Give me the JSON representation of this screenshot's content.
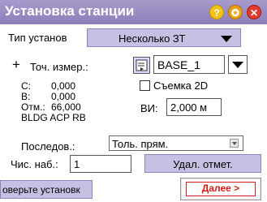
{
  "window": {
    "title": "Установка станции"
  },
  "header_icons": {
    "help": "?",
    "star": "✪",
    "close": "✕"
  },
  "setup_type": {
    "label": "Тип установ",
    "value": "Несколько ЗТ"
  },
  "point": {
    "plus": "+",
    "label": "Точ. измер.:",
    "value": "BASE_1"
  },
  "coords": {
    "c_label": "С:",
    "c_value": "0,000",
    "b_label": "В:",
    "b_value": "0,000",
    "h_label": "Отм.:",
    "h_value": "66,000",
    "code": "BLDG ACP RB"
  },
  "survey2d": {
    "label": "Съемка 2D",
    "checked": false
  },
  "hi": {
    "label": "ВИ:",
    "value": "2,000 м"
  },
  "sequence": {
    "label": "Последов.:",
    "value": "Толь. прям."
  },
  "count": {
    "label": "Чис. наб.:",
    "value": "1"
  },
  "buttons": {
    "delete": "Удал. отмет.",
    "finish": "оверьте установк",
    "next": "Далее >"
  },
  "colors": {
    "title_bar": "#8a7db8",
    "button": "#c6c0e3",
    "next_accent": "#d61a1a"
  }
}
